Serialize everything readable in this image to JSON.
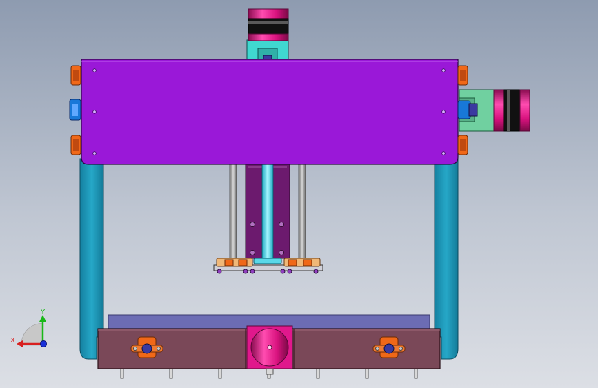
{
  "viewport": {
    "title": "",
    "background_top": "#8e9bb0",
    "background_bottom": "#dcdfe5"
  },
  "model": {
    "colors": {
      "gantry_plate": "#9a18d8",
      "frame_legs": "#1c98b8",
      "base_rail": "#7a4858",
      "bed_plate": "#6c6cb4",
      "motor_magenta": "#e0188c",
      "motor_black": "#111111",
      "mount_cyan": "#40d8d0",
      "mount_green": "#70d0a0",
      "z_carriage": "#6c1a6e",
      "spindle": "#4ad8e8",
      "bearing_orange": "#f06818",
      "guide_rod": "#8d8d8d"
    },
    "parts": [
      "top-stepper-motor",
      "side-stepper-motor",
      "bottom-stepper-motor",
      "gantry-plate",
      "left-frame-leg",
      "right-frame-leg",
      "z-axis-carriage",
      "spindle",
      "base-rail",
      "bed-plate",
      "shaft-support-left",
      "shaft-support-right"
    ]
  },
  "axis_triad": {
    "y_label": "Y",
    "x_label": "X",
    "y_color": "#18b818",
    "x_color": "#d82020",
    "z_color": "#1830d8"
  }
}
